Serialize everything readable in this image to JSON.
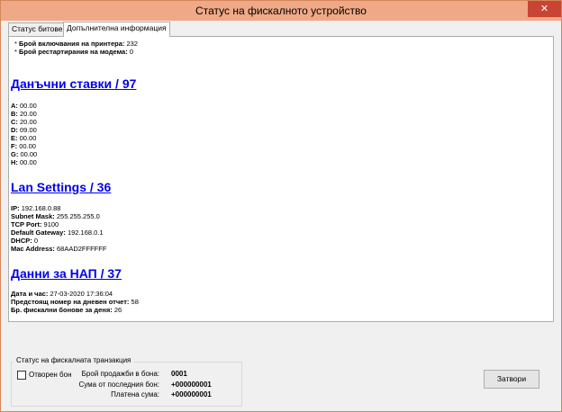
{
  "window": {
    "title": "Статус на фискалното устройство",
    "close_glyph": "✕"
  },
  "tabs": [
    {
      "label": "Статус битове"
    },
    {
      "label": "Допълнителна информация"
    }
  ],
  "content": {
    "printer_starts_label": "Брой включвания на принтера:",
    "printer_starts_value": "232",
    "modem_restarts_label": "Брой рестартирания на модема:",
    "modem_restarts_value": "0",
    "tax_heading": "Данъчни ставки / 97",
    "tax_rates": [
      {
        "k": "A:",
        "v": "00.00"
      },
      {
        "k": "B:",
        "v": "20.00"
      },
      {
        "k": "C:",
        "v": "20.00"
      },
      {
        "k": "D:",
        "v": "09.00"
      },
      {
        "k": "E:",
        "v": "00.00"
      },
      {
        "k": "F:",
        "v": "00.00"
      },
      {
        "k": "G:",
        "v": "00.00"
      },
      {
        "k": "H:",
        "v": "00.00"
      }
    ],
    "lan_heading": "Lan Settings / 36",
    "lan": [
      {
        "k": "IP:",
        "v": "192.168.0.88"
      },
      {
        "k": "Subnet Mask:",
        "v": "255.255.255.0"
      },
      {
        "k": "TCP Port:",
        "v": "9100"
      },
      {
        "k": "Default Gateway:",
        "v": "192.168.0.1"
      },
      {
        "k": "DHCP:",
        "v": "0"
      },
      {
        "k": "Mac Address:",
        "v": "68AAD2FFFFFF"
      }
    ],
    "nap_heading": "Данни за НАП / 37",
    "nap": [
      {
        "k": "Дата и час:",
        "v": "27-03-2020 17:36:04"
      },
      {
        "k": "Предстоящ номер на дневен отчет:",
        "v": "58"
      },
      {
        "k": "Бр. фискални бонове за деня:",
        "v": "26"
      }
    ]
  },
  "transaction": {
    "group_title": "Статус на фискалната транзакция",
    "open_receipt_label": "Отворен бон",
    "sales_count_label": "Брой продажби в бона:",
    "sales_count_value": "0001",
    "last_receipt_sum_label": "Сума от последния бон:",
    "last_receipt_sum_value": "+000000001",
    "paid_sum_label": "Платена сума:",
    "paid_sum_value": "+000000001"
  },
  "buttons": {
    "close_label": "Затвори"
  }
}
